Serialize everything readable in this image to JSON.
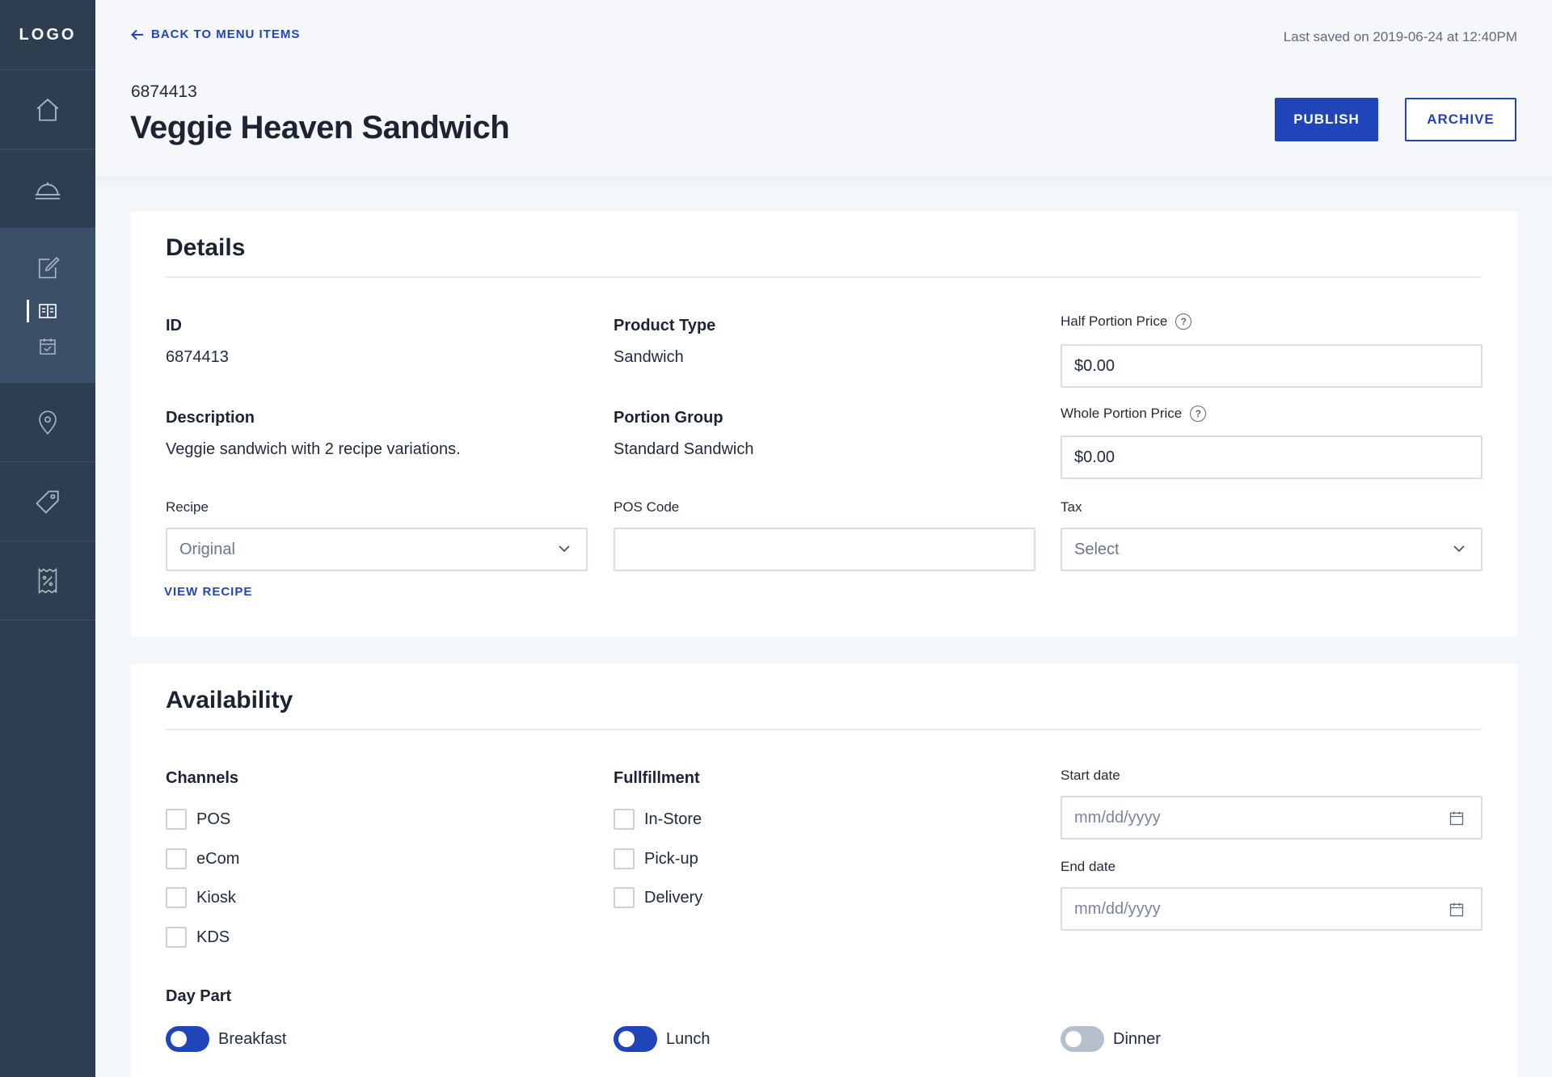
{
  "sidebar": {
    "logo": "LOGO",
    "items": [
      {
        "name": "home",
        "icon": "home-icon"
      },
      {
        "name": "service",
        "icon": "service-bell-icon"
      },
      {
        "name": "menu-editor",
        "icon": "edit-icon",
        "sub": [
          "book-icon",
          "calendar-check-icon"
        ]
      },
      {
        "name": "locations",
        "icon": "map-pin-icon"
      },
      {
        "name": "tags",
        "icon": "tag-icon"
      },
      {
        "name": "discounts",
        "icon": "receipt-percent-icon"
      }
    ]
  },
  "header": {
    "back_label": "BACK TO MENU ITEMS",
    "last_saved": "Last saved on 2019-06-24 at 12:40PM",
    "item_id": "6874413",
    "title": "Veggie Heaven Sandwich",
    "publish_label": "PUBLISH",
    "archive_label": "ARCHIVE"
  },
  "details": {
    "title": "Details",
    "id_label": "ID",
    "id_value": "6874413",
    "product_type_label": "Product Type",
    "product_type_value": "Sandwich",
    "half_price_label": "Half Portion Price",
    "half_price_value": "$0.00",
    "description_label": "Description",
    "description_value": "Veggie sandwich with 2 recipe variations.",
    "portion_group_label": "Portion Group",
    "portion_group_value": "Standard Sandwich",
    "whole_price_label": "Whole Portion Price",
    "whole_price_value": "$0.00",
    "recipe_label": "Recipe",
    "recipe_value": "Original",
    "pos_code_label": "POS Code",
    "pos_code_value": "",
    "tax_label": "Tax",
    "tax_value": "Select",
    "view_recipe": "VIEW RECIPE",
    "help_glyph": "?"
  },
  "availability": {
    "title": "Availability",
    "channels_label": "Channels",
    "channels": [
      "POS",
      "eCom",
      "Kiosk",
      "KDS"
    ],
    "fulfillment_label": "Fullfillment",
    "fulfillment": [
      "In-Store",
      "Pick-up",
      "Delivery"
    ],
    "start_date_label": "Start date",
    "start_date_placeholder": "mm/dd/yyyy",
    "end_date_label": "End date",
    "end_date_placeholder": "mm/dd/yyyy",
    "day_part_label": "Day Part",
    "day_parts": [
      {
        "label": "Breakfast",
        "on": true
      },
      {
        "label": "Lunch",
        "on": true
      },
      {
        "label": "Dinner",
        "on": false
      }
    ]
  },
  "colors": {
    "sidebar": "#2c3e50",
    "sidebar_active": "#3a5068",
    "accent": "#1f45b8",
    "toggle_off": "#b6c0cd"
  }
}
